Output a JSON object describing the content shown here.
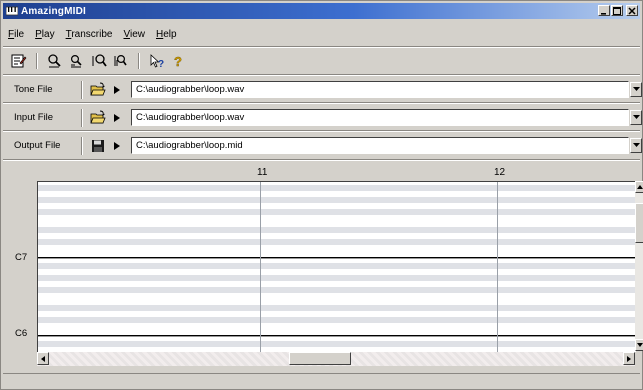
{
  "window": {
    "title": "AmazingMIDI"
  },
  "menu": [
    {
      "pre": "",
      "ul": "F",
      "post": "ile"
    },
    {
      "pre": "",
      "ul": "P",
      "post": "lay"
    },
    {
      "pre": "",
      "ul": "T",
      "post": "ranscribe"
    },
    {
      "pre": "",
      "ul": "V",
      "post": "iew"
    },
    {
      "pre": "",
      "ul": "H",
      "post": "elp"
    }
  ],
  "files": {
    "tone": {
      "label": "Tone File",
      "path": "C:\\audiograbber\\loop.wav"
    },
    "input": {
      "label": "Input File",
      "path": "C:\\audiograbber\\loop.wav"
    },
    "output": {
      "label": "Output File",
      "path": "C:\\audiograbber\\loop.mid"
    }
  },
  "roll": {
    "ruler": [
      {
        "label": "11"
      },
      {
        "label": "12"
      }
    ],
    "notes": [
      {
        "label": "C7"
      },
      {
        "label": "C6"
      }
    ]
  },
  "colors": {
    "title_start": "#1e3f8f",
    "title_end": "#b6cdee",
    "roll_stripe": "#dfe1e6",
    "roll_bg": "#ffffff"
  }
}
